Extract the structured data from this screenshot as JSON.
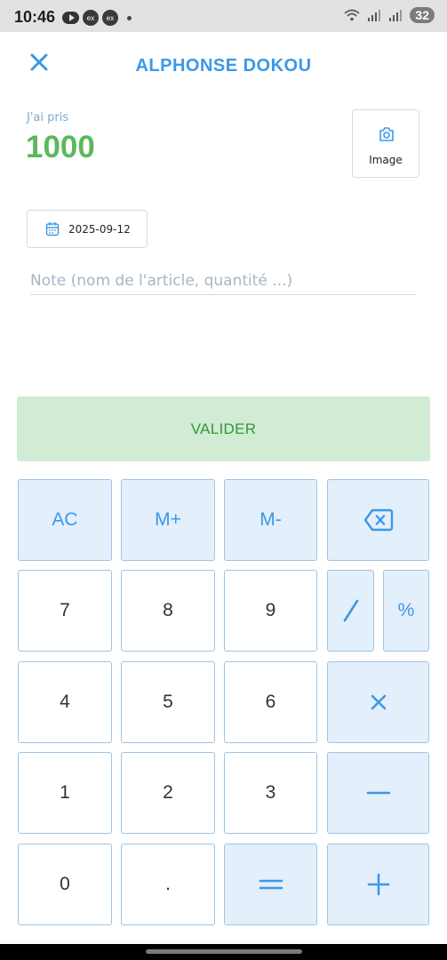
{
  "status_bar": {
    "time": "10:46",
    "notif_icons": [
      "youtube-icon",
      "ex",
      "ex"
    ],
    "battery": "32"
  },
  "header": {
    "title": "ALPHONSE DOKOU",
    "close_icon": "close-icon"
  },
  "amount": {
    "label": "J'ai pris",
    "value": "1000"
  },
  "image_button": {
    "label": "Image",
    "icon": "camera-icon"
  },
  "date_button": {
    "value": "2025-09-12",
    "icon": "calendar-icon"
  },
  "note": {
    "value": "",
    "placeholder": "Note (nom de l'article, quantité ...)"
  },
  "valider": {
    "label": "VALIDER"
  },
  "keypad": {
    "ac": "AC",
    "m_plus": "M+",
    "m_minus": "M-",
    "backspace_icon": "backspace-icon",
    "k7": "7",
    "k8": "8",
    "k9": "9",
    "divide_icon": "divide-icon",
    "percent": "%",
    "k4": "4",
    "k5": "5",
    "k6": "6",
    "multiply_icon": "multiply-icon",
    "k1": "1",
    "k2": "2",
    "k3": "3",
    "minus_icon": "minus-icon",
    "k0": "0",
    "dot": ".",
    "equals_icon": "equals-icon",
    "plus_icon": "plus-icon"
  },
  "colors": {
    "accent": "#3b98e8",
    "amount_green": "#5cb85c",
    "valider_bg": "#d1ebd4",
    "valider_text": "#2f9a35",
    "op_key_bg": "#e3effb"
  }
}
